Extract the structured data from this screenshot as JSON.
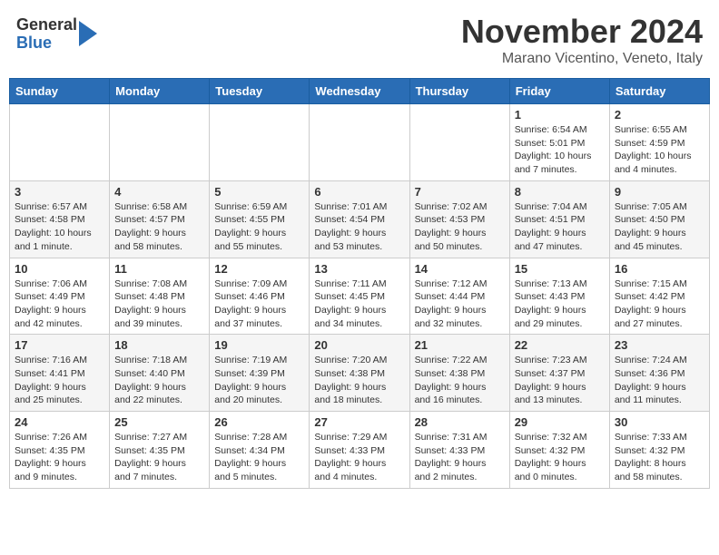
{
  "logo": {
    "general": "General",
    "blue": "Blue"
  },
  "header": {
    "month": "November 2024",
    "location": "Marano Vicentino, Veneto, Italy"
  },
  "weekdays": [
    "Sunday",
    "Monday",
    "Tuesday",
    "Wednesday",
    "Thursday",
    "Friday",
    "Saturday"
  ],
  "weeks": [
    [
      {
        "day": "",
        "info": ""
      },
      {
        "day": "",
        "info": ""
      },
      {
        "day": "",
        "info": ""
      },
      {
        "day": "",
        "info": ""
      },
      {
        "day": "",
        "info": ""
      },
      {
        "day": "1",
        "info": "Sunrise: 6:54 AM\nSunset: 5:01 PM\nDaylight: 10 hours and 7 minutes."
      },
      {
        "day": "2",
        "info": "Sunrise: 6:55 AM\nSunset: 4:59 PM\nDaylight: 10 hours and 4 minutes."
      }
    ],
    [
      {
        "day": "3",
        "info": "Sunrise: 6:57 AM\nSunset: 4:58 PM\nDaylight: 10 hours and 1 minute."
      },
      {
        "day": "4",
        "info": "Sunrise: 6:58 AM\nSunset: 4:57 PM\nDaylight: 9 hours and 58 minutes."
      },
      {
        "day": "5",
        "info": "Sunrise: 6:59 AM\nSunset: 4:55 PM\nDaylight: 9 hours and 55 minutes."
      },
      {
        "day": "6",
        "info": "Sunrise: 7:01 AM\nSunset: 4:54 PM\nDaylight: 9 hours and 53 minutes."
      },
      {
        "day": "7",
        "info": "Sunrise: 7:02 AM\nSunset: 4:53 PM\nDaylight: 9 hours and 50 minutes."
      },
      {
        "day": "8",
        "info": "Sunrise: 7:04 AM\nSunset: 4:51 PM\nDaylight: 9 hours and 47 minutes."
      },
      {
        "day": "9",
        "info": "Sunrise: 7:05 AM\nSunset: 4:50 PM\nDaylight: 9 hours and 45 minutes."
      }
    ],
    [
      {
        "day": "10",
        "info": "Sunrise: 7:06 AM\nSunset: 4:49 PM\nDaylight: 9 hours and 42 minutes."
      },
      {
        "day": "11",
        "info": "Sunrise: 7:08 AM\nSunset: 4:48 PM\nDaylight: 9 hours and 39 minutes."
      },
      {
        "day": "12",
        "info": "Sunrise: 7:09 AM\nSunset: 4:46 PM\nDaylight: 9 hours and 37 minutes."
      },
      {
        "day": "13",
        "info": "Sunrise: 7:11 AM\nSunset: 4:45 PM\nDaylight: 9 hours and 34 minutes."
      },
      {
        "day": "14",
        "info": "Sunrise: 7:12 AM\nSunset: 4:44 PM\nDaylight: 9 hours and 32 minutes."
      },
      {
        "day": "15",
        "info": "Sunrise: 7:13 AM\nSunset: 4:43 PM\nDaylight: 9 hours and 29 minutes."
      },
      {
        "day": "16",
        "info": "Sunrise: 7:15 AM\nSunset: 4:42 PM\nDaylight: 9 hours and 27 minutes."
      }
    ],
    [
      {
        "day": "17",
        "info": "Sunrise: 7:16 AM\nSunset: 4:41 PM\nDaylight: 9 hours and 25 minutes."
      },
      {
        "day": "18",
        "info": "Sunrise: 7:18 AM\nSunset: 4:40 PM\nDaylight: 9 hours and 22 minutes."
      },
      {
        "day": "19",
        "info": "Sunrise: 7:19 AM\nSunset: 4:39 PM\nDaylight: 9 hours and 20 minutes."
      },
      {
        "day": "20",
        "info": "Sunrise: 7:20 AM\nSunset: 4:38 PM\nDaylight: 9 hours and 18 minutes."
      },
      {
        "day": "21",
        "info": "Sunrise: 7:22 AM\nSunset: 4:38 PM\nDaylight: 9 hours and 16 minutes."
      },
      {
        "day": "22",
        "info": "Sunrise: 7:23 AM\nSunset: 4:37 PM\nDaylight: 9 hours and 13 minutes."
      },
      {
        "day": "23",
        "info": "Sunrise: 7:24 AM\nSunset: 4:36 PM\nDaylight: 9 hours and 11 minutes."
      }
    ],
    [
      {
        "day": "24",
        "info": "Sunrise: 7:26 AM\nSunset: 4:35 PM\nDaylight: 9 hours and 9 minutes."
      },
      {
        "day": "25",
        "info": "Sunrise: 7:27 AM\nSunset: 4:35 PM\nDaylight: 9 hours and 7 minutes."
      },
      {
        "day": "26",
        "info": "Sunrise: 7:28 AM\nSunset: 4:34 PM\nDaylight: 9 hours and 5 minutes."
      },
      {
        "day": "27",
        "info": "Sunrise: 7:29 AM\nSunset: 4:33 PM\nDaylight: 9 hours and 4 minutes."
      },
      {
        "day": "28",
        "info": "Sunrise: 7:31 AM\nSunset: 4:33 PM\nDaylight: 9 hours and 2 minutes."
      },
      {
        "day": "29",
        "info": "Sunrise: 7:32 AM\nSunset: 4:32 PM\nDaylight: 9 hours and 0 minutes."
      },
      {
        "day": "30",
        "info": "Sunrise: 7:33 AM\nSunset: 4:32 PM\nDaylight: 8 hours and 58 minutes."
      }
    ]
  ]
}
